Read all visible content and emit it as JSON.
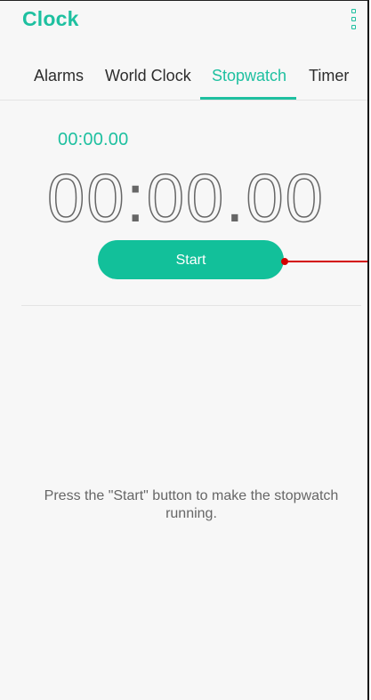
{
  "app": {
    "title": "Clock"
  },
  "header": {
    "menu_icon": "overflow-menu-icon"
  },
  "tabs": [
    {
      "label": "Alarms",
      "active": false
    },
    {
      "label": "World Clock",
      "active": false
    },
    {
      "label": "Stopwatch",
      "active": true
    },
    {
      "label": "Timer",
      "active": false
    }
  ],
  "stopwatch": {
    "lap_time": "00:00.00",
    "main_time": {
      "part1": "00",
      "sep1": ":",
      "part2": "00",
      "sep2": ".",
      "part3": "00"
    },
    "start_label": "Start",
    "hint": "Press the \"Start\" button to make the stopwatch running."
  },
  "colors": {
    "accent": "#1ec0a0",
    "button": "#12c09a",
    "text": "#2d2d2d",
    "muted": "#666666",
    "pointer": "#d30000"
  }
}
